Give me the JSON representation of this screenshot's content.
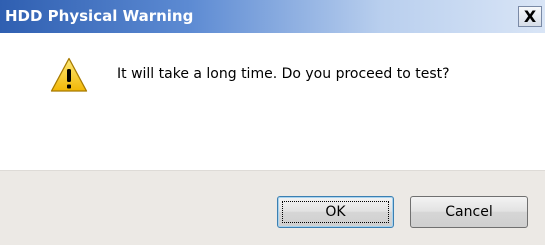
{
  "dialog": {
    "title": "HDD Physical Warning",
    "close_label": "X",
    "icon": "warning-icon",
    "message": "It will take a long time. Do you proceed to test?",
    "buttons": {
      "ok_label": "OK",
      "cancel_label": "Cancel"
    }
  },
  "colors": {
    "titlebar_start": "#2f5fb1",
    "titlebar_end": "#d9e5f6",
    "footer_bg": "#ece9e5",
    "warning_yellow": "#f7c916"
  }
}
